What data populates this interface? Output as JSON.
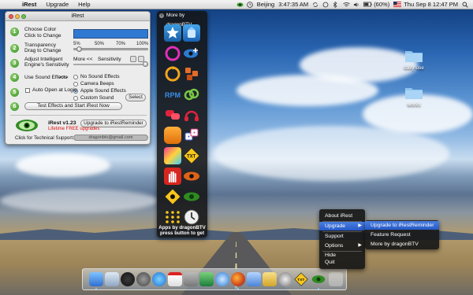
{
  "menubar": {
    "app_name": "iRest",
    "menus": [
      "Upgrade",
      "Help"
    ],
    "clock_city": "Beijing",
    "clock_time": "3:47:35 AM",
    "battery": "(60%)",
    "date_time": "Thu Sep 8  12:47 PM"
  },
  "settings": {
    "title": "iRest",
    "steps": [
      {
        "num": "1",
        "text1": "Choose Color",
        "text2": "Click to Change"
      },
      {
        "num": "2",
        "text1": "Transparency",
        "text2": "Drag to Change"
      },
      {
        "num": "3",
        "text1": "Adjust Intelligent",
        "text2": "Engine's Sensitivity"
      },
      {
        "num": "4",
        "text1": "Use Sound Effects",
        "text2": ">>>"
      },
      {
        "num": "5",
        "text1": "Auto Open at Login",
        "text2": ""
      },
      {
        "num": "6",
        "text1": "",
        "text2": ""
      }
    ],
    "color_value": "#2f79d2",
    "transparency_ticks": [
      "5%",
      "50%",
      "70%",
      "100%"
    ],
    "transparency_level_pct": 5,
    "sensitivity_more": "More <<",
    "sensitivity_label": "Sensitivity",
    "sensitivity_level_pct": 100,
    "sound_options": [
      "No Sound Effects",
      "Camera Beeps",
      "Apple Sound Effects",
      "Custom Sound"
    ],
    "sound_selected": "Apple Sound Effects",
    "select_button": "Select",
    "auto_open_checked": false,
    "test_button": "Test Effects and Start iRest Now",
    "version": "iRest  v1.23",
    "upgrade_button": "Upgrade to iRestReminder",
    "lifetime_text": "Lifetime FREE upgrades",
    "support_label": "Click for Technical Support:",
    "support_email": "dragonbtv@gmail.com"
  },
  "more_panel": {
    "title": "More by dragonBTV",
    "footer_line1": "Apps by dragonBTV",
    "footer_line2": "press button to get",
    "icons": [
      "star-badge-icon",
      "paint-bucket-icon",
      "refresh-ring-icon",
      "eye-plus-icon",
      "arrows-cycle-icon",
      "blocks-icon",
      "rpm-icon",
      "link-icon",
      "speech-bubbles-icon",
      "headphones-icon",
      "orange-app-icon",
      "dice-icon",
      "txt-icon",
      "txt-sign-icon",
      "hand-stop-icon",
      "eye-red-icon",
      "warning-sign-icon",
      "eye-green-icon",
      "stars-icon",
      "clock-icon"
    ]
  },
  "desktop": {
    "folders": [
      {
        "label": "daily use"
      },
      {
        "label": "works"
      }
    ]
  },
  "context_menu": {
    "items": [
      "About iRest",
      "Upgrade",
      "Support",
      "Options",
      "Hide",
      "Quit"
    ],
    "highlighted": "Upgrade",
    "submenu": [
      "Upgrade to iRestReminder",
      "Feature Request",
      "More by dragonBTV"
    ],
    "submenu_highlighted": "Upgrade to iRestReminder"
  },
  "dock": {
    "icons": [
      "finder-icon",
      "mail-icon",
      "dashboard-icon",
      "system-preferences-icon",
      "itunes-icon",
      "ical-icon",
      "preview-icon",
      "iphoto-icon",
      "safari-icon",
      "firefox-icon",
      "launchpad-icon",
      "eye-app-icon",
      "textedit-icon",
      "clock-app-icon",
      "txt-app-icon",
      "irest-eye-icon"
    ]
  },
  "colors": {
    "accent": "#2659c6",
    "green_step": "#2e8b1c",
    "lifetime_red": "#d11111"
  }
}
